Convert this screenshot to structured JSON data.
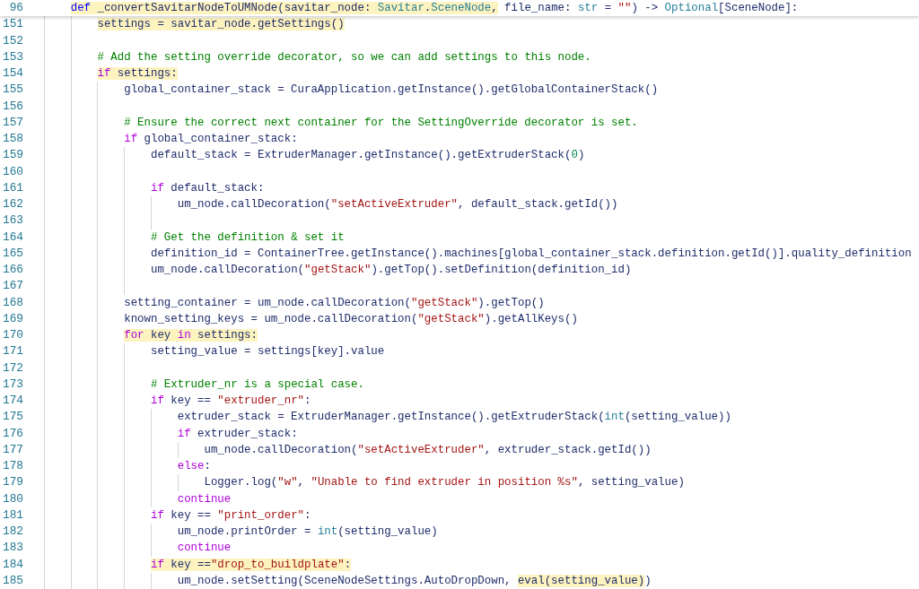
{
  "sticky_line": {
    "number": "96",
    "tokens": [
      {
        "text": "    def",
        "kind": "keyword",
        "highlighted": true
      },
      {
        "text": " _convertSavitarNodeToUMNode(savitar_node: ",
        "kind": "plain",
        "highlighted": true
      },
      {
        "text": "Savitar",
        "kind": "type",
        "highlighted": true
      },
      {
        "text": ".",
        "kind": "plain",
        "highlighted": true
      },
      {
        "text": "SceneNode",
        "kind": "type",
        "highlighted": true
      },
      {
        "text": ",",
        "kind": "plain",
        "highlighted": true
      },
      {
        "text": " file_name: ",
        "kind": "plain",
        "highlighted": false
      },
      {
        "text": "str",
        "kind": "type",
        "highlighted": false
      },
      {
        "text": " = ",
        "kind": "plain",
        "highlighted": false
      },
      {
        "text": "\"\"",
        "kind": "string",
        "highlighted": false
      },
      {
        "text": ") -> ",
        "kind": "plain",
        "highlighted": false
      },
      {
        "text": "Optional",
        "kind": "type",
        "highlighted": false
      },
      {
        "text": "[SceneNode]:",
        "kind": "plain",
        "highlighted": false
      }
    ]
  },
  "lines": [
    {
      "number": "151",
      "tokens": [
        {
          "text": "        settings = savitar_node.getSettings()",
          "kind": "plain",
          "highlighted": true
        }
      ]
    },
    {
      "number": "152"
    },
    {
      "number": "153",
      "tokens": [
        {
          "text": "        # Add the setting override decorator, so we can add settings to this node.",
          "kind": "comment",
          "highlighted": false
        }
      ]
    },
    {
      "number": "154",
      "tokens": [
        {
          "text": "        if",
          "kind": "control",
          "highlighted": true
        },
        {
          "text": " settings:",
          "kind": "plain",
          "highlighted": true
        }
      ]
    },
    {
      "number": "155",
      "tokens": [
        {
          "text": "            global_container_stack = CuraApplication.getInstance().getGlobalContainerStack()",
          "kind": "plain",
          "highlighted": false
        }
      ]
    },
    {
      "number": "156"
    },
    {
      "number": "157",
      "tokens": [
        {
          "text": "            # Ensure the correct next container for the SettingOverride decorator is set.",
          "kind": "comment",
          "highlighted": false
        }
      ]
    },
    {
      "number": "158",
      "tokens": [
        {
          "text": "            if",
          "kind": "control",
          "highlighted": false
        },
        {
          "text": " global_container_stack:",
          "kind": "plain",
          "highlighted": false
        }
      ]
    },
    {
      "number": "159",
      "tokens": [
        {
          "text": "                default_stack = ExtruderManager.getInstance().getExtruderStack(",
          "kind": "plain",
          "highlighted": false
        },
        {
          "text": "0",
          "kind": "number",
          "highlighted": false
        },
        {
          "text": ")",
          "kind": "plain",
          "highlighted": false
        }
      ]
    },
    {
      "number": "160"
    },
    {
      "number": "161",
      "tokens": [
        {
          "text": "                if",
          "kind": "control",
          "highlighted": false
        },
        {
          "text": " default_stack:",
          "kind": "plain",
          "highlighted": false
        }
      ]
    },
    {
      "number": "162",
      "tokens": [
        {
          "text": "                    um_node.callDecoration(",
          "kind": "plain",
          "highlighted": false
        },
        {
          "text": "\"setActiveExtruder\"",
          "kind": "string",
          "highlighted": false
        },
        {
          "text": ", default_stack.getId())",
          "kind": "plain",
          "highlighted": false
        }
      ]
    },
    {
      "number": "163"
    },
    {
      "number": "164",
      "tokens": [
        {
          "text": "                # Get the definition & set it",
          "kind": "comment",
          "highlighted": false
        }
      ]
    },
    {
      "number": "165",
      "tokens": [
        {
          "text": "                definition_id = ContainerTree.getInstance().machines[global_container_stack.definition.getId()].quality_definition",
          "kind": "plain",
          "highlighted": false
        }
      ]
    },
    {
      "number": "166",
      "tokens": [
        {
          "text": "                um_node.callDecoration(",
          "kind": "plain",
          "highlighted": false
        },
        {
          "text": "\"getStack\"",
          "kind": "string",
          "highlighted": false
        },
        {
          "text": ").getTop().setDefinition(definition_id)",
          "kind": "plain",
          "highlighted": false
        }
      ]
    },
    {
      "number": "167"
    },
    {
      "number": "168",
      "tokens": [
        {
          "text": "            setting_container = um_node.callDecoration(",
          "kind": "plain",
          "highlighted": false
        },
        {
          "text": "\"getStack\"",
          "kind": "string",
          "highlighted": false
        },
        {
          "text": ").getTop()",
          "kind": "plain",
          "highlighted": false
        }
      ]
    },
    {
      "number": "169",
      "tokens": [
        {
          "text": "            known_setting_keys = um_node.callDecoration(",
          "kind": "plain",
          "highlighted": false
        },
        {
          "text": "\"getStack\"",
          "kind": "string",
          "highlighted": false
        },
        {
          "text": ").getAllKeys()",
          "kind": "plain",
          "highlighted": false
        }
      ]
    },
    {
      "number": "170",
      "tokens": [
        {
          "text": "            for",
          "kind": "control",
          "highlighted": true
        },
        {
          "text": " key ",
          "kind": "plain",
          "highlighted": true
        },
        {
          "text": "in",
          "kind": "control",
          "highlighted": true
        },
        {
          "text": " settings:",
          "kind": "plain",
          "highlighted": true
        }
      ]
    },
    {
      "number": "171",
      "tokens": [
        {
          "text": "                setting_value = settings[key].value",
          "kind": "plain",
          "highlighted": false
        }
      ]
    },
    {
      "number": "172"
    },
    {
      "number": "173",
      "tokens": [
        {
          "text": "                # Extruder_nr is a special case.",
          "kind": "comment",
          "highlighted": false
        }
      ]
    },
    {
      "number": "174",
      "tokens": [
        {
          "text": "                if",
          "kind": "control",
          "highlighted": false
        },
        {
          "text": " key == ",
          "kind": "plain",
          "highlighted": false
        },
        {
          "text": "\"extruder_nr\"",
          "kind": "string",
          "highlighted": false
        },
        {
          "text": ":",
          "kind": "plain",
          "highlighted": false
        }
      ]
    },
    {
      "number": "175",
      "tokens": [
        {
          "text": "                    extruder_stack = ExtruderManager.getInstance().getExtruderStack(",
          "kind": "plain",
          "highlighted": false
        },
        {
          "text": "int",
          "kind": "type",
          "highlighted": false
        },
        {
          "text": "(setting_value))",
          "kind": "plain",
          "highlighted": false
        }
      ]
    },
    {
      "number": "176",
      "tokens": [
        {
          "text": "                    if",
          "kind": "control",
          "highlighted": false
        },
        {
          "text": " extruder_stack:",
          "kind": "plain",
          "highlighted": false
        }
      ]
    },
    {
      "number": "177",
      "tokens": [
        {
          "text": "                        um_node.callDecoration(",
          "kind": "plain",
          "highlighted": false
        },
        {
          "text": "\"setActiveExtruder\"",
          "kind": "string",
          "highlighted": false
        },
        {
          "text": ", extruder_stack.getId())",
          "kind": "plain",
          "highlighted": false
        }
      ]
    },
    {
      "number": "178",
      "tokens": [
        {
          "text": "                    else",
          "kind": "control",
          "highlighted": false
        },
        {
          "text": ":",
          "kind": "plain",
          "highlighted": false
        }
      ]
    },
    {
      "number": "179",
      "tokens": [
        {
          "text": "                        Logger.log(",
          "kind": "plain",
          "highlighted": false
        },
        {
          "text": "\"w\"",
          "kind": "string",
          "highlighted": false
        },
        {
          "text": ", ",
          "kind": "plain",
          "highlighted": false
        },
        {
          "text": "\"Unable to find extruder in position %s\"",
          "kind": "string",
          "highlighted": false
        },
        {
          "text": ", setting_value)",
          "kind": "plain",
          "highlighted": false
        }
      ]
    },
    {
      "number": "180",
      "tokens": [
        {
          "text": "                    continue",
          "kind": "control",
          "highlighted": false
        }
      ]
    },
    {
      "number": "181",
      "tokens": [
        {
          "text": "                if",
          "kind": "control",
          "highlighted": false
        },
        {
          "text": " key == ",
          "kind": "plain",
          "highlighted": false
        },
        {
          "text": "\"print_order\"",
          "kind": "string",
          "highlighted": false
        },
        {
          "text": ":",
          "kind": "plain",
          "highlighted": false
        }
      ]
    },
    {
      "number": "182",
      "tokens": [
        {
          "text": "                    um_node.printOrder = ",
          "kind": "plain",
          "highlighted": false
        },
        {
          "text": "int",
          "kind": "type",
          "highlighted": false
        },
        {
          "text": "(setting_value)",
          "kind": "plain",
          "highlighted": false
        }
      ]
    },
    {
      "number": "183",
      "tokens": [
        {
          "text": "                    continue",
          "kind": "control",
          "highlighted": false
        }
      ]
    },
    {
      "number": "184",
      "tokens": [
        {
          "text": "                if",
          "kind": "control",
          "highlighted": true
        },
        {
          "text": " key ==",
          "kind": "plain",
          "highlighted": true
        },
        {
          "text": "\"drop_to_buildplate\"",
          "kind": "string",
          "highlighted": true
        },
        {
          "text": ":",
          "kind": "plain",
          "highlighted": true
        }
      ]
    },
    {
      "number": "185",
      "tokens": [
        {
          "text": "                    um_node.setSetting(SceneNodeSettings.AutoDropDown, ",
          "kind": "plain",
          "highlighted": false
        },
        {
          "text": "eval(setting_value)",
          "kind": "plain",
          "highlighted": true
        },
        {
          "text": ")",
          "kind": "plain",
          "highlighted": false
        }
      ]
    }
  ]
}
